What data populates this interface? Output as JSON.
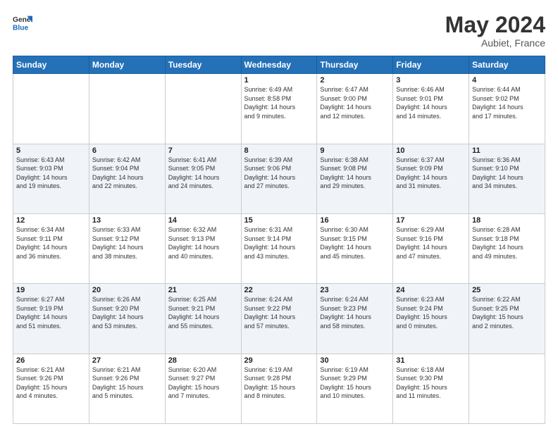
{
  "header": {
    "logo_general": "General",
    "logo_blue": "Blue",
    "month_title": "May 2024",
    "location": "Aubiet, France"
  },
  "weekdays": [
    "Sunday",
    "Monday",
    "Tuesday",
    "Wednesday",
    "Thursday",
    "Friday",
    "Saturday"
  ],
  "weeks": [
    [
      {
        "day": "",
        "info": ""
      },
      {
        "day": "",
        "info": ""
      },
      {
        "day": "",
        "info": ""
      },
      {
        "day": "1",
        "info": "Sunrise: 6:49 AM\nSunset: 8:58 PM\nDaylight: 14 hours\nand 9 minutes."
      },
      {
        "day": "2",
        "info": "Sunrise: 6:47 AM\nSunset: 9:00 PM\nDaylight: 14 hours\nand 12 minutes."
      },
      {
        "day": "3",
        "info": "Sunrise: 6:46 AM\nSunset: 9:01 PM\nDaylight: 14 hours\nand 14 minutes."
      },
      {
        "day": "4",
        "info": "Sunrise: 6:44 AM\nSunset: 9:02 PM\nDaylight: 14 hours\nand 17 minutes."
      }
    ],
    [
      {
        "day": "5",
        "info": "Sunrise: 6:43 AM\nSunset: 9:03 PM\nDaylight: 14 hours\nand 19 minutes."
      },
      {
        "day": "6",
        "info": "Sunrise: 6:42 AM\nSunset: 9:04 PM\nDaylight: 14 hours\nand 22 minutes."
      },
      {
        "day": "7",
        "info": "Sunrise: 6:41 AM\nSunset: 9:05 PM\nDaylight: 14 hours\nand 24 minutes."
      },
      {
        "day": "8",
        "info": "Sunrise: 6:39 AM\nSunset: 9:06 PM\nDaylight: 14 hours\nand 27 minutes."
      },
      {
        "day": "9",
        "info": "Sunrise: 6:38 AM\nSunset: 9:08 PM\nDaylight: 14 hours\nand 29 minutes."
      },
      {
        "day": "10",
        "info": "Sunrise: 6:37 AM\nSunset: 9:09 PM\nDaylight: 14 hours\nand 31 minutes."
      },
      {
        "day": "11",
        "info": "Sunrise: 6:36 AM\nSunset: 9:10 PM\nDaylight: 14 hours\nand 34 minutes."
      }
    ],
    [
      {
        "day": "12",
        "info": "Sunrise: 6:34 AM\nSunset: 9:11 PM\nDaylight: 14 hours\nand 36 minutes."
      },
      {
        "day": "13",
        "info": "Sunrise: 6:33 AM\nSunset: 9:12 PM\nDaylight: 14 hours\nand 38 minutes."
      },
      {
        "day": "14",
        "info": "Sunrise: 6:32 AM\nSunset: 9:13 PM\nDaylight: 14 hours\nand 40 minutes."
      },
      {
        "day": "15",
        "info": "Sunrise: 6:31 AM\nSunset: 9:14 PM\nDaylight: 14 hours\nand 43 minutes."
      },
      {
        "day": "16",
        "info": "Sunrise: 6:30 AM\nSunset: 9:15 PM\nDaylight: 14 hours\nand 45 minutes."
      },
      {
        "day": "17",
        "info": "Sunrise: 6:29 AM\nSunset: 9:16 PM\nDaylight: 14 hours\nand 47 minutes."
      },
      {
        "day": "18",
        "info": "Sunrise: 6:28 AM\nSunset: 9:18 PM\nDaylight: 14 hours\nand 49 minutes."
      }
    ],
    [
      {
        "day": "19",
        "info": "Sunrise: 6:27 AM\nSunset: 9:19 PM\nDaylight: 14 hours\nand 51 minutes."
      },
      {
        "day": "20",
        "info": "Sunrise: 6:26 AM\nSunset: 9:20 PM\nDaylight: 14 hours\nand 53 minutes."
      },
      {
        "day": "21",
        "info": "Sunrise: 6:25 AM\nSunset: 9:21 PM\nDaylight: 14 hours\nand 55 minutes."
      },
      {
        "day": "22",
        "info": "Sunrise: 6:24 AM\nSunset: 9:22 PM\nDaylight: 14 hours\nand 57 minutes."
      },
      {
        "day": "23",
        "info": "Sunrise: 6:24 AM\nSunset: 9:23 PM\nDaylight: 14 hours\nand 58 minutes."
      },
      {
        "day": "24",
        "info": "Sunrise: 6:23 AM\nSunset: 9:24 PM\nDaylight: 15 hours\nand 0 minutes."
      },
      {
        "day": "25",
        "info": "Sunrise: 6:22 AM\nSunset: 9:25 PM\nDaylight: 15 hours\nand 2 minutes."
      }
    ],
    [
      {
        "day": "26",
        "info": "Sunrise: 6:21 AM\nSunset: 9:26 PM\nDaylight: 15 hours\nand 4 minutes."
      },
      {
        "day": "27",
        "info": "Sunrise: 6:21 AM\nSunset: 9:26 PM\nDaylight: 15 hours\nand 5 minutes."
      },
      {
        "day": "28",
        "info": "Sunrise: 6:20 AM\nSunset: 9:27 PM\nDaylight: 15 hours\nand 7 minutes."
      },
      {
        "day": "29",
        "info": "Sunrise: 6:19 AM\nSunset: 9:28 PM\nDaylight: 15 hours\nand 8 minutes."
      },
      {
        "day": "30",
        "info": "Sunrise: 6:19 AM\nSunset: 9:29 PM\nDaylight: 15 hours\nand 10 minutes."
      },
      {
        "day": "31",
        "info": "Sunrise: 6:18 AM\nSunset: 9:30 PM\nDaylight: 15 hours\nand 11 minutes."
      },
      {
        "day": "",
        "info": ""
      }
    ]
  ]
}
